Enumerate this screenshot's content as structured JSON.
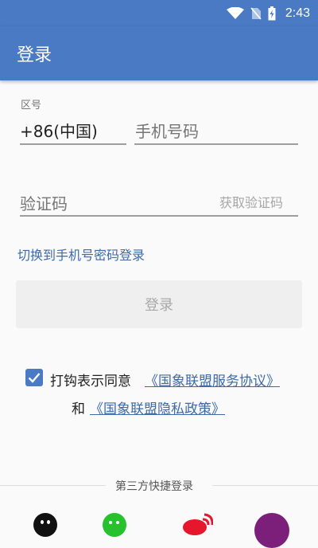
{
  "status_bar": {
    "time": "2:43"
  },
  "app_bar": {
    "title": "登录"
  },
  "form": {
    "region_label": "区号",
    "region_value": "+86(中国)",
    "phone_placeholder": "手机号码",
    "code_placeholder": "验证码",
    "get_code_button": "获取验证码"
  },
  "switch_login_link": "切换到手机号密码登录",
  "login_button": "登录",
  "agreement": {
    "checked": true,
    "prefix": "打钩表示同意",
    "service_agreement": "《国象联盟服务协议》",
    "and": "和",
    "privacy_policy": "《国象联盟隐私政策》"
  },
  "third_party": {
    "label": "第三方快捷登录",
    "providers": [
      "qq-icon",
      "wechat-icon",
      "weibo-icon",
      "other-login-icon"
    ]
  },
  "colors": {
    "primary": "#4a7ac3",
    "link": "#3d6aa8",
    "button_disabled": "#efefef"
  }
}
